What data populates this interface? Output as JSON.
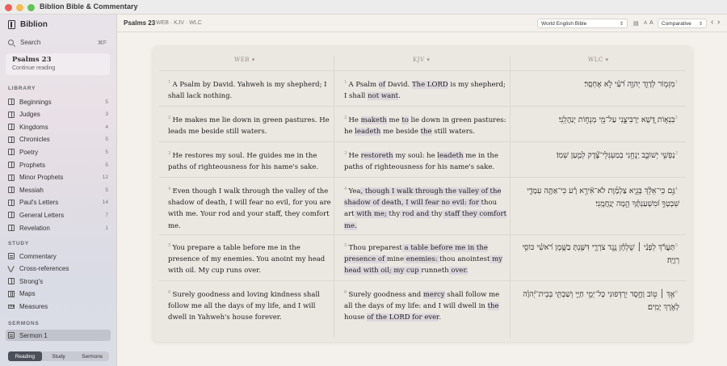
{
  "window": {
    "title": "Biblion Bible & Commentary"
  },
  "sidebar": {
    "brand": "Biblion",
    "search": {
      "label": "Search",
      "shortcut": "⌘F"
    },
    "current": {
      "title": "Psalms 23",
      "subtitle": "Continue reading"
    },
    "library_label": "LIBRARY",
    "library": [
      {
        "label": "Beginnings",
        "count": "5"
      },
      {
        "label": "Judges",
        "count": "3"
      },
      {
        "label": "Kingdoms",
        "count": "4"
      },
      {
        "label": "Chronicles",
        "count": "5"
      },
      {
        "label": "Poetry",
        "count": "5"
      },
      {
        "label": "Prophets",
        "count": "5"
      },
      {
        "label": "Minor Prophets",
        "count": "12"
      },
      {
        "label": "Messiah",
        "count": "5"
      },
      {
        "label": "Paul's Letters",
        "count": "14"
      },
      {
        "label": "General Letters",
        "count": "7"
      },
      {
        "label": "Revelation",
        "count": "1"
      }
    ],
    "study_label": "STUDY",
    "study": [
      {
        "label": "Commentary",
        "icon": "commentary-icon"
      },
      {
        "label": "Cross-references",
        "icon": "cross-references-icon"
      },
      {
        "label": "Strong's",
        "icon": "strongs-icon"
      },
      {
        "label": "Maps",
        "icon": "map-icon"
      },
      {
        "label": "Measures",
        "icon": "ruler-icon"
      }
    ],
    "sermons_label": "SERMONS",
    "sermons": [
      {
        "label": "Sermon 1"
      }
    ],
    "tabs": [
      "Reading",
      "Study",
      "Sermons"
    ]
  },
  "toolbar": {
    "title": "Psalms 23",
    "translations": "WEB · KJV · WLC",
    "bible_select": "World English Bible",
    "font_small": "A",
    "font_large": "A",
    "view_select": "Comparative",
    "prev": "‹",
    "next": "›"
  },
  "columns": [
    {
      "code": "WEB",
      "chevron": "▾"
    },
    {
      "code": "KJV",
      "chevron": "▾"
    },
    {
      "code": "WLC",
      "chevron": "▾"
    }
  ],
  "verses": [
    {
      "num": "1",
      "web": "A Psalm by David. Yahweh is my shepherd; I shall lack nothing.",
      "kjv": [
        "A Psalm ",
        "of",
        " David. ",
        "The LORD",
        " is my shepherd; I shall ",
        "not want",
        "."
      ],
      "wlc": "מִזְמ֥וֹר לְדָוִ֑ד יְהוָ֥ה רֹ֝עִ֗י לֹ֣א אֶחְסָֽר׃"
    },
    {
      "num": "2",
      "web": "He makes me lie down in green pastures. He leads me beside still waters.",
      "kjv": [
        "He ",
        "maketh",
        " me ",
        "to",
        " lie down in green pastures: he ",
        "leadeth",
        " me beside ",
        "the",
        " still waters."
      ],
      "wlc": "בִּנְא֣וֹת דֶּ֭שֶׁא יַרְבִּיצֵ֑נִי עַל־מֵ֖י מְנֻח֣וֹת יְנַהֲלֵֽנִי׃"
    },
    {
      "num": "3",
      "web": "He restores my soul. He guides me in the paths of righteousness for his name's sake.",
      "kjv": [
        "He ",
        "restoreth",
        " my soul: he ",
        "leadeth",
        " me in the paths of righteousness for his name's sake."
      ],
      "wlc": "נַפְשִׁ֥י יְשׁוֹבֵ֑ב יַֽנְחֵ֥נִי בְמַעְגְּלֵי־צֶ֝֗דֶק לְמַ֣עַן שְׁמֽוֹ׃"
    },
    {
      "num": "4",
      "web": "Even though I walk through the valley of the shadow of death, I will fear no evil, for you are with me. Your rod and your staff, they comfort me.",
      "kjv": [
        "Yea",
        ", though I walk through the valley of the shadow of death, I will fear no evil: for ",
        "thou art",
        " with me; ",
        "thy",
        " rod and ",
        "thy",
        " staff they comfort me."
      ],
      "wlc": "גַּ֤ם כִּֽי־אֵלֵ֨ךְ בְּגֵ֪יא צַלְמָ֡וֶת לֹא־אִ֘ירָ֤א רָ֗ע כִּי־אַתָּ֥ה עִמָּדִ֑י שִׁבְטְךָ֥ וּ֝מִשְׁעַנְתֶּ֗ךָ הֵ֣מָּה יְנַֽחֲמֻֽנִי׃"
    },
    {
      "num": "5",
      "web": "You prepare a table before me in the presence of my enemies. You anoint my head with oil. My cup runs over.",
      "kjv": [
        "Thou preparest",
        " a table before me in the presence of ",
        "mine",
        " enemies: ",
        "thou anointest",
        " my head with oil; my cup ",
        "runneth",
        " over."
      ],
      "wlc": "תַּעֲרֹ֬ךְ לְפָנַ֨י ׀ שֻׁלְחָ֗ן נֶ֥גֶד צֹרְרָ֑י דִּשַּׁ֖נְתָּ בַשֶּׁ֥מֶן רֹ֝אשִׁ֗י כּוֹסִ֥י רְוָיָֽה׃"
    },
    {
      "num": "6",
      "web": "Surely goodness and loving kindness shall follow me all the days of my life, and I will dwell in Yahweh's house forever.",
      "kjv": [
        "Surely goodness and ",
        "mercy",
        " shall follow me all the days of my life: and I will dwell in ",
        "the",
        " house ",
        "of the LORD for ever",
        "."
      ],
      "wlc": "אַ֤ךְ ׀ ט֤וֹב וָחֶ֣סֶד יִ֭רְדְּפוּנִי כָּל־יְמֵ֣י חַיָּ֑י וְשַׁבְתִּ֥י בְּבֵית־יְ֝הוָ֗ה לְאֹ֣רֶךְ יָמִֽים׃"
    }
  ]
}
